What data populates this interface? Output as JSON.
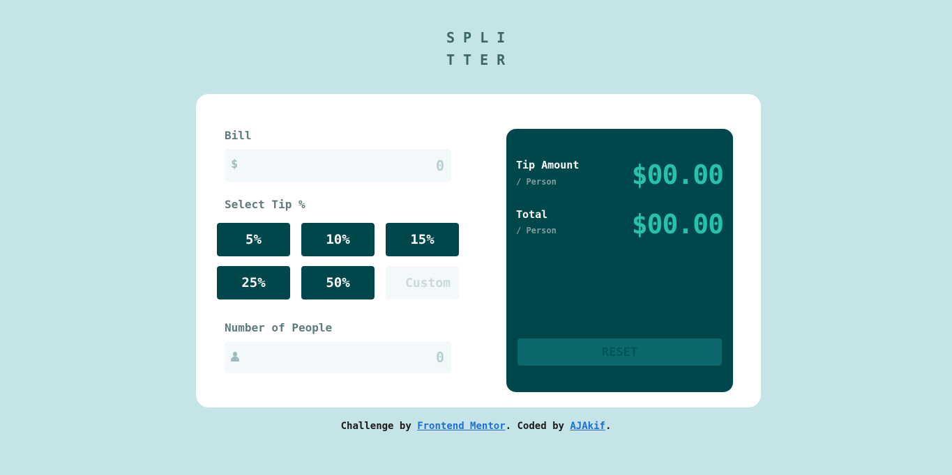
{
  "logo": {
    "line1": "SPLI",
    "line2": "TTER"
  },
  "bill": {
    "label": "Bill",
    "prefix": "$",
    "placeholder": "0",
    "value": ""
  },
  "tip": {
    "label": "Select Tip %",
    "options": [
      "5%",
      "10%",
      "15%",
      "25%",
      "50%"
    ],
    "custom_placeholder": "Custom"
  },
  "people": {
    "label": "Number of People",
    "placeholder": "0",
    "value": ""
  },
  "result": {
    "tip_title": "Tip Amount",
    "tip_sub": "/ Person",
    "tip_value": "$00.00",
    "total_title": "Total",
    "total_sub": "/ Person",
    "total_value": "$00.00",
    "reset_label": "RESET"
  },
  "footer": {
    "prefix": "Challenge by ",
    "link1": "Frontend Mentor",
    "middle": ". Coded by ",
    "link2": "AJAkif",
    "suffix": "."
  },
  "colors": {
    "background": "#c5e4e7",
    "dark_teal": "#00474b",
    "accent": "#26c2ad",
    "link": "#1d6fd6"
  }
}
